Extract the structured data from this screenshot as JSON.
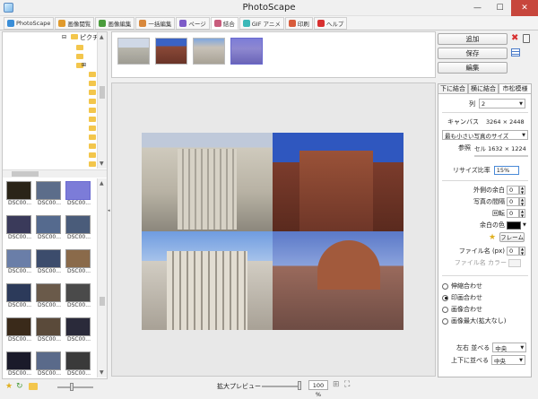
{
  "app": {
    "title": "PhotoScape"
  },
  "window_controls": {
    "minimize": "—",
    "maximize": "☐",
    "close": "✕"
  },
  "tabs": [
    {
      "label": "PhotoScape",
      "color": "#3a8ed8"
    },
    {
      "label": "画像閲覧",
      "color": "#e09a2c"
    },
    {
      "label": "画像編集",
      "color": "#4a9c3c"
    },
    {
      "label": "一括編集",
      "color": "#d8883c"
    },
    {
      "label": "ページ",
      "color": "#7d5cc8"
    },
    {
      "label": "結合",
      "color": "#c85c7c"
    },
    {
      "label": "GIF アニメ",
      "color": "#3cb8b8"
    },
    {
      "label": "印刷",
      "color": "#d85c3c"
    },
    {
      "label": "ヘルプ",
      "color": "#d83030"
    }
  ],
  "tree": {
    "root_label": "ピクチ",
    "expanders": [
      "⊟",
      "⊞"
    ]
  },
  "thumbnails": [
    {
      "label": "DSC00...",
      "selected": false
    },
    {
      "label": "DSC00...",
      "selected": false
    },
    {
      "label": "DSC00...",
      "selected": true
    },
    {
      "label": "DSC00...",
      "selected": false
    },
    {
      "label": "DSC00...",
      "selected": false
    },
    {
      "label": "DSC00...",
      "selected": false
    },
    {
      "label": "DSC00...",
      "selected": false
    },
    {
      "label": "DSC00...",
      "selected": false
    },
    {
      "label": "DSC00...",
      "selected": false
    },
    {
      "label": "DSC00...",
      "selected": false
    },
    {
      "label": "DSC00...",
      "selected": false
    },
    {
      "label": "DSC00...",
      "selected": false
    },
    {
      "label": "DSC00...",
      "selected": false
    },
    {
      "label": "DSC00...",
      "selected": false
    },
    {
      "label": "DSC00...",
      "selected": false
    },
    {
      "label": "DSC00...",
      "selected": false
    },
    {
      "label": "DSC00...",
      "selected": false
    },
    {
      "label": "DSC00...",
      "selected": false
    }
  ],
  "actions": {
    "add": "追加",
    "save": "保存",
    "edit": "編集",
    "delete_icon": "✖"
  },
  "right_tabs": [
    "下に結合",
    "横に結合",
    "市松模様"
  ],
  "panel": {
    "columns_label": "列",
    "columns_value": "2",
    "canvas_label": "キャンバス",
    "canvas_value": "3264 × 2448",
    "size_mode": "最も小さい写真のサイズ",
    "reference_label": "参照",
    "reference_value": "セル 1632 × 1224",
    "ratio_label": "リサイズ比率",
    "ratio_value": "15%",
    "outer_margin_label": "外側の余白",
    "outer_margin_value": "0",
    "spacing_label": "写真の間隔",
    "spacing_value": "0",
    "rotate_label": "回転",
    "rotate_value": "0",
    "margin_color_label": "余白の色",
    "frame_label": "フレーム",
    "filename_label": "ファイル名 (px)",
    "filename_value": "0",
    "filename_color_label": "ファイル名 カラー",
    "fit_options": [
      "伸縮合わせ",
      "印画合わせ",
      "画像合わせ",
      "画像最大(拡大なし)"
    ],
    "fit_selected": 1,
    "halign_label": "左右 並べる",
    "halign_value": "中央",
    "valign_label": "上下に並べる",
    "valign_value": "中央"
  },
  "preview": {
    "zoom_label": "拡大プレビュー",
    "zoom_value": "100 %"
  }
}
